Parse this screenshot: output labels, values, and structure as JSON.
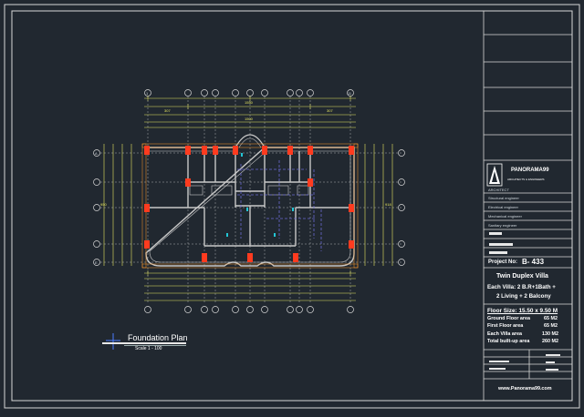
{
  "colors": {
    "background": "#212830",
    "frame": "#d8d8d8",
    "wall": "#c8c8c8",
    "column": "#ff3b1f",
    "dimension": "#e6e660",
    "grid": "#d0d0d0",
    "beam_dashed": "#6a6ad0",
    "cyan": "#22c6d6"
  },
  "company": {
    "name": "PANORAMA99",
    "tagline": "ARCHITECTS & ENGINEERS"
  },
  "title_block": {
    "architect": "ARCHITECT",
    "structural": "Structural engineer",
    "electrical": "Electrical engineer",
    "mechanical": "Mechanical engineer",
    "sanitary": "Sanitary engineer"
  },
  "project": {
    "label": "Project No:",
    "number": "B- 433",
    "title_line1": "Twin Duplex Villa",
    "title_line2": "Each Villa: 2 B.R+1Bath +",
    "title_line3": "2 Living + 2 Balcony"
  },
  "areas": [
    {
      "label": "Floor Size: 15.50 x 9.50 M",
      "value": ""
    },
    {
      "label": "Ground Floor area",
      "value": "65 M2"
    },
    {
      "label": "First Floor area",
      "value": "65 M2"
    },
    {
      "label": "Each Villa area",
      "value": "130 M2"
    },
    {
      "label": "Total built-up area",
      "value": "260 M2"
    }
  ],
  "website": "www.Panorama99.com",
  "plan": {
    "title": "Foundation Plan",
    "scale": "Scale   1 - 100"
  },
  "grid_labels": {
    "columns": [
      "1",
      "2",
      "3",
      "4",
      "5",
      "6",
      "7",
      "8",
      "9",
      "10",
      "11"
    ],
    "rows": [
      "A",
      "B",
      "C",
      "D",
      "E"
    ]
  },
  "dimensions": {
    "overall_top": "1550",
    "overall_inner": "1500",
    "top_segments": [
      "307",
      "",
      "",
      "",
      "",
      "",
      "",
      "",
      "",
      "",
      "307"
    ],
    "side_total": "950",
    "side_inner": "918"
  }
}
